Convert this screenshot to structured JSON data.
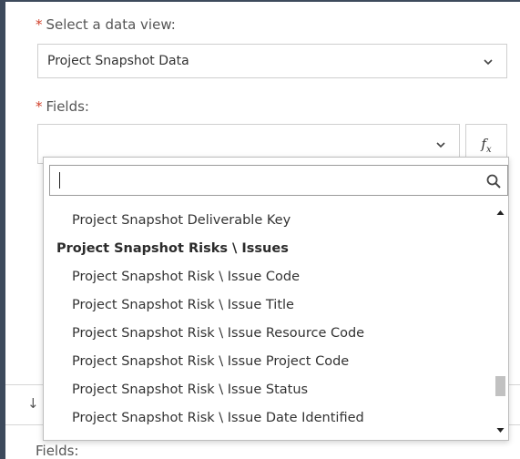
{
  "data_view": {
    "required_mark": "*",
    "label": "Select a data view:",
    "selected_value": "Project Snapshot Data"
  },
  "fields": {
    "required_mark": "*",
    "label": "Fields:",
    "selected_value": "",
    "fx_label": "f",
    "fx_sub": "x"
  },
  "dropdown": {
    "search_value": "",
    "items": [
      {
        "label": "Project Snapshot Deliverable Key",
        "group": false
      },
      {
        "label": "Project Snapshot Risks \\ Issues",
        "group": true
      },
      {
        "label": "Project Snapshot Risk \\ Issue Code",
        "group": false
      },
      {
        "label": "Project Snapshot Risk \\ Issue Title",
        "group": false
      },
      {
        "label": "Project Snapshot Risk \\ Issue Resource Code",
        "group": false
      },
      {
        "label": "Project Snapshot Risk \\ Issue Project Code",
        "group": false
      },
      {
        "label": "Project Snapshot Risk \\ Issue Status",
        "group": false
      },
      {
        "label": "Project Snapshot Risk \\ Issue Date Identified",
        "group": false
      }
    ],
    "scroll_position": 0.86
  },
  "background": {
    "partial_icon": "↓",
    "bottom_label": "Fields:"
  }
}
